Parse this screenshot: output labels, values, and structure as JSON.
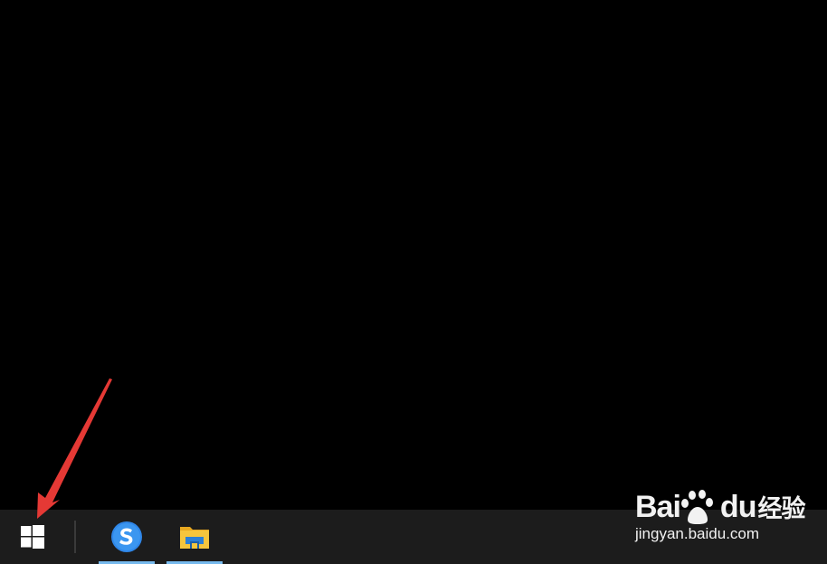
{
  "taskbar": {
    "start_button": {
      "icon": "windows-logo-icon"
    },
    "apps": [
      {
        "name": "Sogou Browser",
        "icon": "sogou-browser-icon",
        "running": true
      },
      {
        "name": "File Explorer",
        "icon": "folder-icon",
        "running": true
      }
    ],
    "colors": {
      "background": "#1c1c1c",
      "running_indicator": "#76b9ed"
    }
  },
  "annotation": {
    "arrow_color": "#e53935",
    "points_to": "start-button"
  },
  "watermark": {
    "logo_text_1": "Bai",
    "logo_text_2": "du",
    "logo_cn": "经验",
    "url": "jingyan.baidu.com"
  }
}
